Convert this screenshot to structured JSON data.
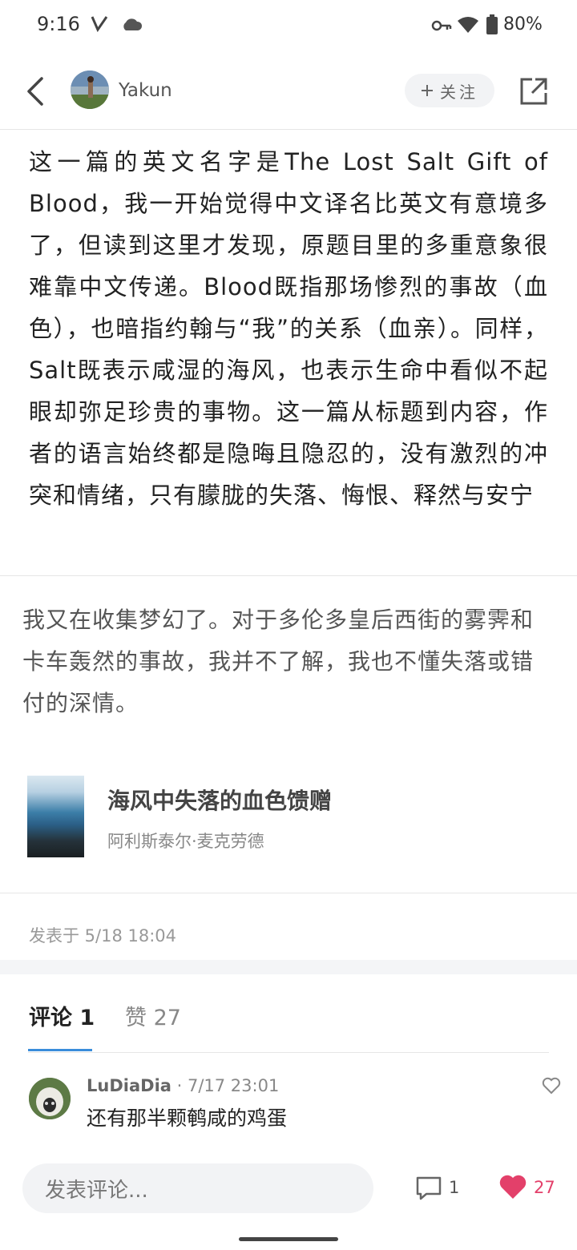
{
  "status_bar": {
    "time": "9:16",
    "battery": "80%"
  },
  "header": {
    "username": "Yakun",
    "follow_label": "关注"
  },
  "post": {
    "quote": "这一篇的英文名字是The Lost Salt Gift of Blood，我一开始觉得中文译名比英文有意境多了，但读到这里才发现，原题目里的多重意象很难靠中文传递。Blood既指那场惨烈的事故（血色），也暗指约翰与“我”的关系（血亲）。同样，Salt既表示咸湿的海风，也表示生命中看似不起眼却弥足珍贵的事物。这一篇从标题到内容，作者的语言始终都是隐晦且隐忍的，没有激烈的冲突和情绪，只有朦胧的失落、悔恨、释然与安宁",
    "review": "我又在收集梦幻了。对于多伦多皇后西街的雾霁和卡车轰然的事故，我并不了解，我也不懂失落或错付的深情。",
    "book": {
      "title": "海风中失落的血色馈赠",
      "author": "阿利斯泰尔·麦克劳德"
    },
    "posted": "发表于 5/18 18:04"
  },
  "tabs": {
    "comments": "评论 1",
    "likes": "赞 27"
  },
  "comments": [
    {
      "author": "LuDiaDia",
      "time": "· 7/17 23:01",
      "text": "还有那半颗鹌咸的鸡蛋"
    }
  ],
  "bottom_bar": {
    "placeholder": "发表评论...",
    "comment_count": "1",
    "like_count": "27"
  },
  "colors": {
    "accent": "#3a8ddb",
    "like": "#e3406a"
  }
}
